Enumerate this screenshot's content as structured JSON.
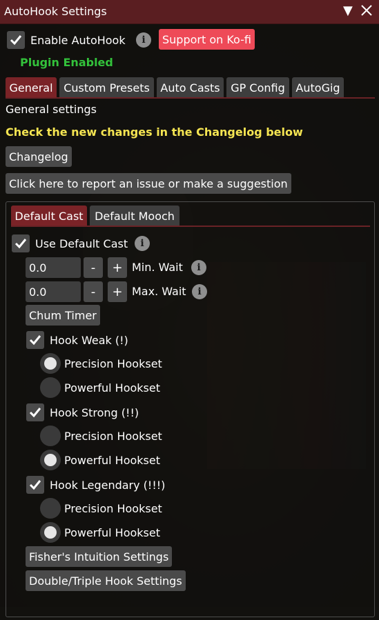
{
  "window": {
    "title": "AutoHook Settings",
    "collapse_icon": "triangle-down-icon",
    "close_icon": "close-icon"
  },
  "top": {
    "enable_label": "Enable AutoHook",
    "enable_checked": true,
    "kofi_label": "Support on Ko-fi",
    "status_text": "Plugin Enabled"
  },
  "main_tabs": [
    {
      "label": "General",
      "active": true
    },
    {
      "label": "Custom Presets",
      "active": false
    },
    {
      "label": "Auto Casts",
      "active": false
    },
    {
      "label": "GP Config",
      "active": false
    },
    {
      "label": "AutoGig",
      "active": false
    }
  ],
  "general": {
    "heading": "General settings",
    "notice": "Check the new changes in the Changelog below",
    "changelog_button": "Changelog",
    "report_button": "Click here to report an issue or make a suggestion"
  },
  "cast_tabs": [
    {
      "label": "Default Cast",
      "active": true
    },
    {
      "label": "Default Mooch",
      "active": false
    }
  ],
  "default_cast": {
    "use_label": "Use Default Cast",
    "use_checked": true,
    "min_wait": {
      "value": "0.0",
      "label": "Min. Wait"
    },
    "max_wait": {
      "value": "0.0",
      "label": "Max. Wait"
    },
    "minus": "-",
    "plus": "+",
    "chum_timer_button": "Chum Timer",
    "hooks": [
      {
        "label": "Hook Weak (!)",
        "checked": true,
        "options": [
          "Precision Hookset",
          "Powerful Hookset"
        ],
        "selected": 0
      },
      {
        "label": "Hook Strong (!!)",
        "checked": true,
        "options": [
          "Precision Hookset",
          "Powerful Hookset"
        ],
        "selected": 1
      },
      {
        "label": "Hook Legendary (!!!)",
        "checked": true,
        "options": [
          "Precision Hookset",
          "Powerful Hookset"
        ],
        "selected": 1
      }
    ],
    "fishers_intuition_button": "Fisher's Intuition Settings",
    "double_triple_button": "Double/Triple Hook Settings"
  },
  "colors": {
    "title_bg": "#5a1e21",
    "active_tab": "#7a2327",
    "kofi": "#ee4a58",
    "status_green": "#33c23b",
    "notice_yellow": "#f5e552"
  }
}
